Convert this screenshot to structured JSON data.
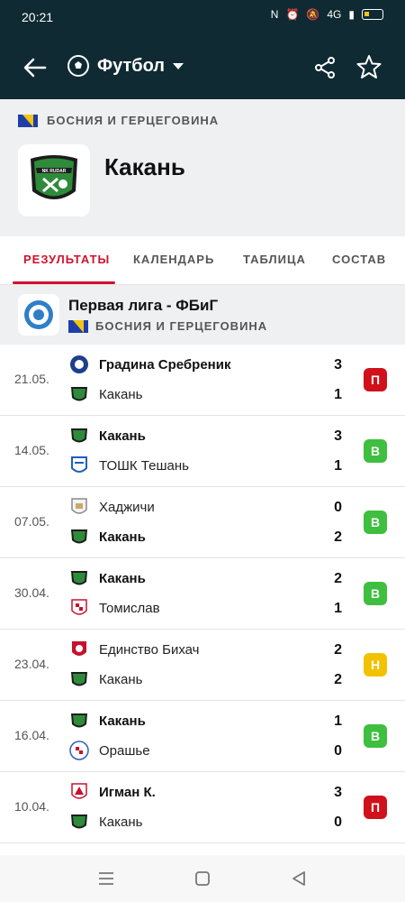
{
  "status_bar": {
    "time": "20:21",
    "network": "4G"
  },
  "app_bar": {
    "sport": "Футбол",
    "back_icon": "arrow-left-icon",
    "share_icon": "share-icon",
    "favorite_icon": "star-icon"
  },
  "team_header": {
    "country": "БОСНИЯ И ГЕРЦЕГОВИНА",
    "team_name": "Какань",
    "logo_text": "NK RUDAR"
  },
  "tabs": [
    {
      "label": "РЕЗУЛЬТАТЫ",
      "active": true
    },
    {
      "label": "КАЛЕНДАРЬ",
      "active": false
    },
    {
      "label": "ТАБЛИЦА",
      "active": false
    },
    {
      "label": "СОСТАВ",
      "active": false
    }
  ],
  "league": {
    "name": "Первая лига - ФБиГ",
    "country": "БОСНИЯ И ГЕРЦЕГОВИНА"
  },
  "matches": [
    {
      "date": "21.05.",
      "home": "Градина Сребреник",
      "away": "Какань",
      "home_score": "3",
      "away_score": "1",
      "result": "П",
      "result_color": "#d0111b",
      "winner": "home"
    },
    {
      "date": "14.05.",
      "home": "Какань",
      "away": "ТОШК Тешань",
      "home_score": "3",
      "away_score": "1",
      "result": "В",
      "result_color": "#3fbf3f",
      "winner": "home"
    },
    {
      "date": "07.05.",
      "home": "Хаджичи",
      "away": "Какань",
      "home_score": "0",
      "away_score": "2",
      "result": "В",
      "result_color": "#3fbf3f",
      "winner": "away"
    },
    {
      "date": "30.04.",
      "home": "Какань",
      "away": "Томислав",
      "home_score": "2",
      "away_score": "1",
      "result": "В",
      "result_color": "#3fbf3f",
      "winner": "home"
    },
    {
      "date": "23.04.",
      "home": "Единство Бихач",
      "away": "Какань",
      "home_score": "2",
      "away_score": "2",
      "result": "Н",
      "result_color": "#f2c200",
      "winner": "none"
    },
    {
      "date": "16.04.",
      "home": "Какань",
      "away": "Орашье",
      "home_score": "1",
      "away_score": "0",
      "result": "В",
      "result_color": "#3fbf3f",
      "winner": "home"
    },
    {
      "date": "10.04.",
      "home": "Игман К.",
      "away": "Какань",
      "home_score": "3",
      "away_score": "0",
      "result": "П",
      "result_color": "#d0111b",
      "winner": "home"
    }
  ],
  "colors": {
    "header_bg": "#0f2a33",
    "accent": "#d0112b"
  }
}
